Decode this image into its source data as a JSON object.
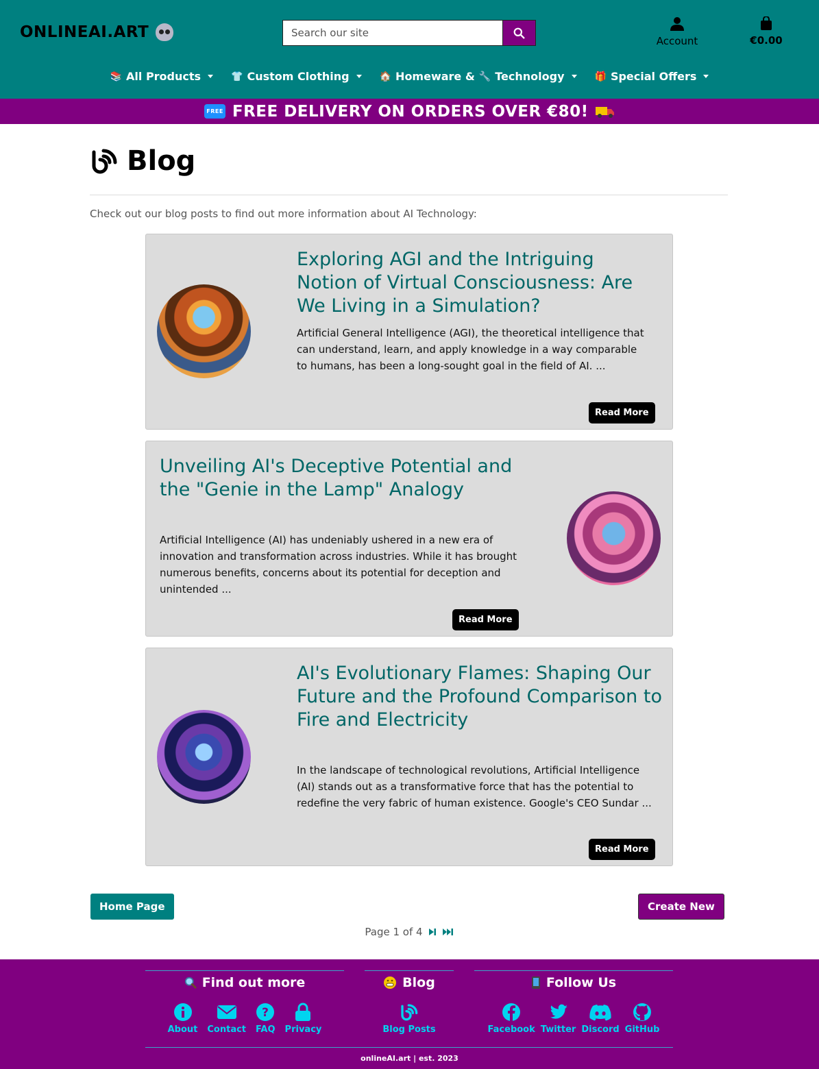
{
  "header": {
    "logo": "ONLINEAI.ART",
    "search_placeholder": "Search our site",
    "account_label": "Account",
    "cart_total": "€0.00"
  },
  "nav": [
    {
      "icon": "books-icon",
      "label": "All Products"
    },
    {
      "icon": "tshirt-icon",
      "label": "Custom Clothing"
    },
    {
      "icon": "house-icon",
      "label": "Homeware &"
    },
    {
      "icon": "wrench-icon",
      "label": "Technology"
    },
    {
      "icon": "gift-icon",
      "label": "Special Offers"
    }
  ],
  "promo": {
    "badge": "FREE",
    "text": "FREE DELIVERY ON ORDERS OVER €80!"
  },
  "page": {
    "title": "Blog",
    "intro": "Check out our blog posts to find out more information about AI Technology:"
  },
  "posts": [
    {
      "title": "Exploring AGI and the Intriguing Notion of Virtual Consciousness: Are We Living in a Simulation?",
      "excerpt": "Artificial General Intelligence (AGI), the theoretical intelligence that can understand, learn, and apply knowledge in a way comparable to humans, has been a long-sought goal in the field of AI. ...",
      "button": "Read More"
    },
    {
      "title": "Unveiling AI's Deceptive Potential and the \"Genie in the Lamp\" Analogy",
      "excerpt": "Artificial Intelligence (AI) has undeniably ushered in a new era of innovation and transformation across industries. While it has brought numerous benefits, concerns about its potential for deception and unintended ...",
      "button": "Read More"
    },
    {
      "title": "AI's Evolutionary Flames: Shaping Our Future and the Profound Comparison to Fire and Electricity",
      "excerpt": "In the landscape of technological revolutions, Artificial Intelligence (AI) stands out as a transformative force that has the potential to redefine the very fabric of human existence. Google's CEO Sundar ...",
      "button": "Read More"
    }
  ],
  "actions": {
    "home": "Home Page",
    "create": "Create New"
  },
  "pagination": {
    "text": "Page 1 of 4"
  },
  "footer": {
    "find_out_more": {
      "heading": "Find out more",
      "links": [
        "About",
        "Contact",
        "FAQ",
        "Privacy"
      ]
    },
    "blog": {
      "heading": "Blog",
      "links": [
        "Blog Posts"
      ]
    },
    "follow_us": {
      "heading": "Follow Us",
      "links": [
        "Facebook",
        "Twitter",
        "Discord",
        "GitHub"
      ]
    },
    "copyright": "onlineAI.art | est. 2023"
  },
  "colors": {
    "teal": "#008080",
    "purple": "#800080",
    "card": "#dcdcdc",
    "link": "#00d4f0"
  }
}
